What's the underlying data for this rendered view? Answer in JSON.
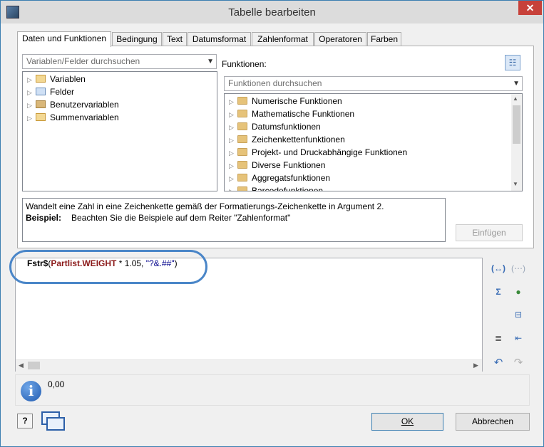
{
  "window": {
    "title": "Tabelle bearbeiten",
    "close": "✕"
  },
  "tabs": [
    "Daten und Funktionen",
    "Bedingung",
    "Text",
    "Datumsformat",
    "Zahlenformat",
    "Operatoren",
    "Farben"
  ],
  "left": {
    "search_placeholder": "Variablen/Felder durchsuchen",
    "items": [
      "Variablen",
      "Felder",
      "Benutzervariablen",
      "Summenvariablen"
    ]
  },
  "right": {
    "label": "Funktionen:",
    "search_placeholder": "Funktionen durchsuchen",
    "items": [
      "Numerische Funktionen",
      "Mathematische Funktionen",
      "Datumsfunktionen",
      "Zeichenkettenfunktionen",
      "Projekt- und Druckabhängige Funktionen",
      "Diverse Funktionen",
      "Aggregatsfunktionen",
      "Barcodefunktionen"
    ]
  },
  "description": {
    "line1": "Wandelt eine Zahl in eine Zeichenkette gemäß der Formatierungs-Zeichenkette in Argument 2.",
    "example_label": "Beispiel:",
    "example_text": "Beachten Sie die Beispiele auf dem Reiter \"Zahlenformat\""
  },
  "insert_button": "Einfügen",
  "formula": {
    "func": "Fstr$",
    "open": "(",
    "field": "Partlist.WEIGHT",
    "op": " * 1.05, ",
    "string": "\"?&.##\"",
    "close": ")"
  },
  "status": {
    "value": "0,00"
  },
  "buttons": {
    "ok": "OK",
    "cancel": "Abbrechen"
  }
}
